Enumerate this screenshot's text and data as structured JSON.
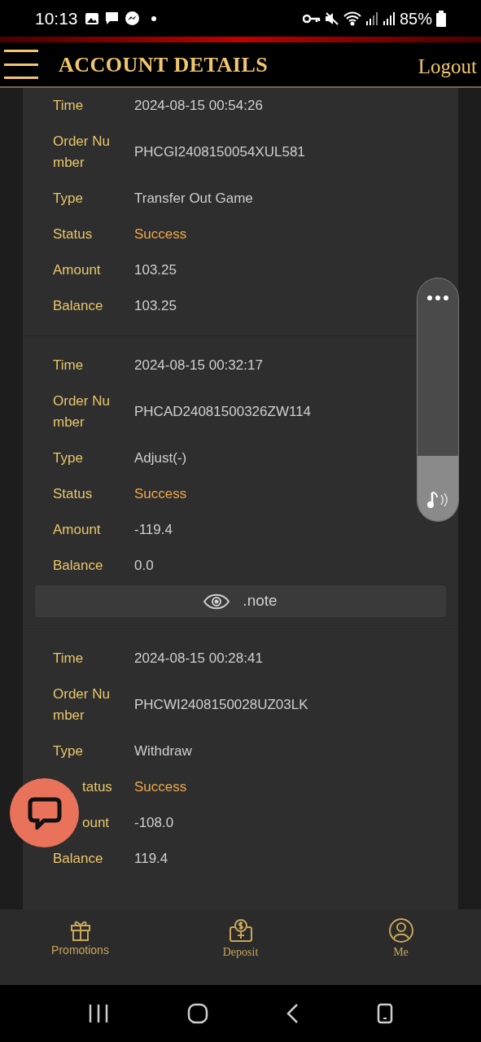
{
  "status_bar": {
    "time": "10:13",
    "battery": "85%"
  },
  "header": {
    "title": "ACCOUNT DETAILS",
    "logout": "Logout"
  },
  "records": [
    {
      "fields": [
        {
          "label": "Time",
          "value": "2024-08-15 00:54:26",
          "kind": "text"
        },
        {
          "label": "Order Number",
          "value": "PHCGI2408150054XUL581",
          "kind": "text"
        },
        {
          "label": "Type",
          "value": "Transfer Out Game",
          "kind": "text"
        },
        {
          "label": "Status",
          "value": "Success",
          "kind": "status"
        },
        {
          "label": "Amount",
          "value": "103.25",
          "kind": "text"
        },
        {
          "label": "Balance",
          "value": "103.25",
          "kind": "text"
        }
      ]
    },
    {
      "fields": [
        {
          "label": "Time",
          "value": "2024-08-15 00:32:17",
          "kind": "text"
        },
        {
          "label": "Order Number",
          "value": "PHCAD24081500326ZW114",
          "kind": "text"
        },
        {
          "label": "Type",
          "value": "Adjust(-)",
          "kind": "text"
        },
        {
          "label": "Status",
          "value": "Success",
          "kind": "status"
        },
        {
          "label": "Amount",
          "value": "-119.4",
          "kind": "text"
        },
        {
          "label": "Balance",
          "value": "0.0",
          "kind": "text"
        }
      ],
      "note": ".note"
    },
    {
      "fields": [
        {
          "label": "Time",
          "value": "2024-08-15 00:28:41",
          "kind": "text"
        },
        {
          "label": "Order Number",
          "value": "PHCWI2408150028UZ03LK",
          "kind": "text"
        },
        {
          "label": "Type",
          "value": "Withdraw",
          "kind": "text"
        },
        {
          "label": "tatus",
          "value": "Success",
          "kind": "status",
          "covered": true
        },
        {
          "label": "ount",
          "value": "-108.0",
          "kind": "text",
          "covered": true
        },
        {
          "label": "Balance",
          "value": "119.4",
          "kind": "text"
        }
      ]
    }
  ],
  "volume": {
    "level": 0.27
  },
  "bottom_nav": [
    {
      "label": "Promotions",
      "kind": "gift"
    },
    {
      "label": "Deposit",
      "kind": "deposit"
    },
    {
      "label": "Me",
      "kind": "user"
    }
  ]
}
